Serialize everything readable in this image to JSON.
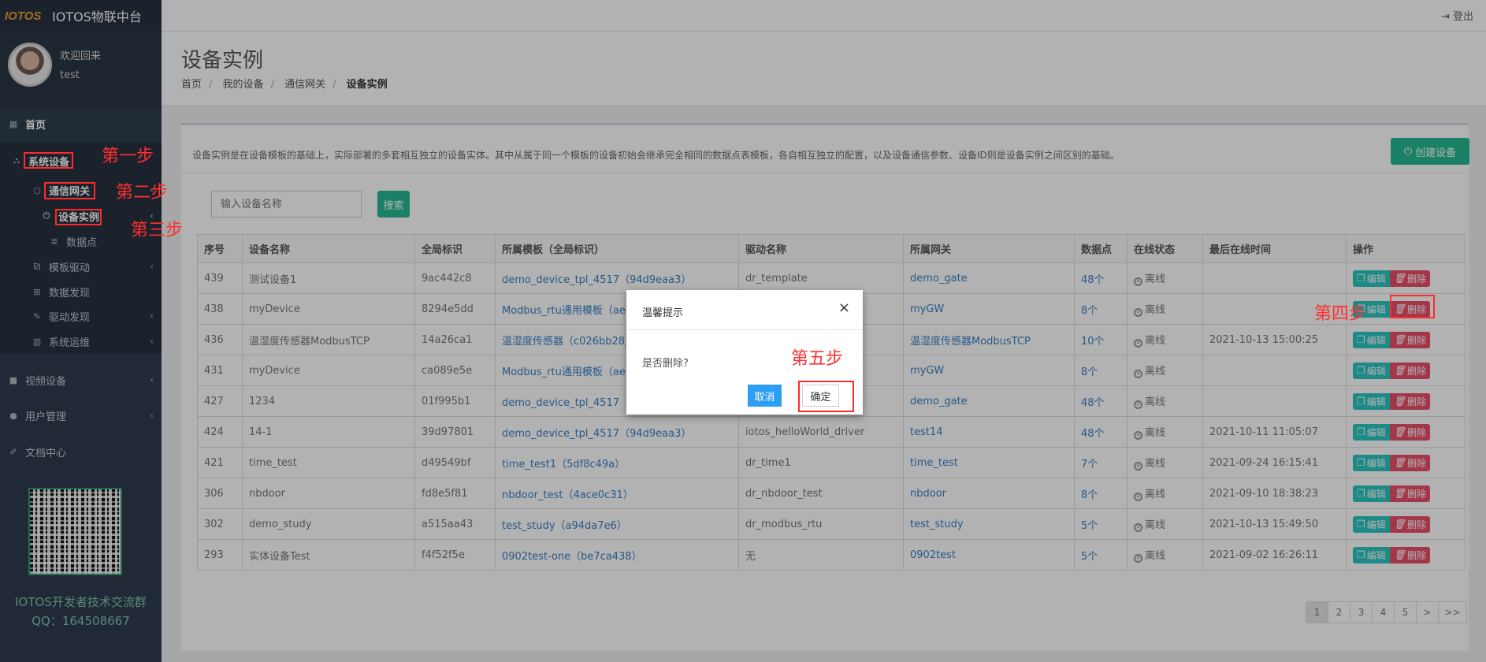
{
  "app": {
    "logo": "IOTOS",
    "title": "IOTOS物联中台",
    "logout": "登出"
  },
  "user": {
    "welcome": "欢迎回来",
    "name": "test"
  },
  "sidebar": {
    "items": [
      {
        "label": "首页",
        "icon": "dashboard-icon"
      },
      {
        "label": "系统设备",
        "icon": "sitemap-icon"
      },
      {
        "label": "通信网关",
        "icon": "circle-icon"
      },
      {
        "label": "设备实例",
        "icon": "rebel-icon"
      },
      {
        "label": "数据点",
        "icon": "database-icon"
      },
      {
        "label": "模板驱动",
        "icon": "template-icon"
      },
      {
        "label": "数据发现",
        "icon": "table-icon"
      },
      {
        "label": "驱动发现",
        "icon": "plug-icon"
      },
      {
        "label": "系统运维",
        "icon": "chart-icon"
      },
      {
        "label": "视频设备",
        "icon": "video-icon"
      },
      {
        "label": "用户管理",
        "icon": "user-icon"
      },
      {
        "label": "文档中心",
        "icon": "edit-icon"
      }
    ],
    "qr_caption": "IOTOS开发者技术交流群",
    "qq": "QQ：164508667"
  },
  "page": {
    "title": "设备实例",
    "breadcrumb": [
      "首页",
      "我的设备",
      "通信网关",
      "设备实例"
    ],
    "description": "设备实例是在设备模板的基础上，实际部署的多套相互独立的设备实体。其中从属于同一个模板的设备初始会继承完全相同的数据点表模板，各自相互独立的配置，以及设备通信参数、设备ID则是设备实例之间区别的基础。",
    "create_button": "创建设备",
    "search_placeholder": "输入设备名称",
    "search_button": "搜索"
  },
  "table": {
    "columns": [
      "序号",
      "设备名称",
      "全局标识",
      "所属模板（全局标识）",
      "驱动名称",
      "所属网关",
      "数据点",
      "在线状态",
      "最后在线时间",
      "操作"
    ],
    "edit_label": "编辑",
    "delete_label": "删除",
    "rows": [
      [
        "439",
        "测试设备1",
        "9ac442c8",
        "demo_device_tpl_4517（94d9eaa3）",
        "dr_template",
        "demo_gate",
        "48个",
        "离线",
        ""
      ],
      [
        "438",
        "myDevice",
        "8294e5dd",
        "Modbus_rtu通用模板（ae6",
        "",
        "myGW",
        "8个",
        "离线",
        ""
      ],
      [
        "436",
        "温湿度传感器ModbusTCP",
        "14a26ca1",
        "温湿度传感器（c026bb28）",
        "",
        "温湿度传感器ModbusTCP",
        "10个",
        "离线",
        "2021-10-13 15:00:25"
      ],
      [
        "431",
        "myDevice",
        "ca089e5e",
        "Modbus_rtu通用模板（ae6",
        "",
        "myGW",
        "8个",
        "离线",
        ""
      ],
      [
        "427",
        "1234",
        "01f995b1",
        "demo_device_tpl_4517（94",
        "",
        "demo_gate",
        "48个",
        "离线",
        ""
      ],
      [
        "424",
        "14-1",
        "39d97801",
        "demo_device_tpl_4517（94d9eaa3）",
        "iotos_helloWorld_driver",
        "test14",
        "48个",
        "离线",
        "2021-10-11 11:05:07"
      ],
      [
        "421",
        "time_test",
        "d49549bf",
        "time_test1（5df8c49a）",
        "dr_time1",
        "time_test",
        "7个",
        "离线",
        "2021-09-24 16:15:41"
      ],
      [
        "306",
        "nbdoor",
        "fd8e5f81",
        "nbdoor_test（4ace0c31）",
        "dr_nbdoor_test",
        "nbdoor",
        "8个",
        "离线",
        "2021-09-10 18:38:23"
      ],
      [
        "302",
        "demo_study",
        "a515aa43",
        "test_study（a94da7e6）",
        "dr_modbus_rtu",
        "test_study",
        "5个",
        "离线",
        "2021-10-13 15:49:50"
      ],
      [
        "293",
        "实体设备Test",
        "f4f52f5e",
        "0902test-one（be7ca438）",
        "无",
        "0902test",
        "5个",
        "离线",
        "2021-09-02 16:26:11"
      ]
    ]
  },
  "pagination": {
    "pages": [
      "1",
      "2",
      "3",
      "4",
      "5",
      ">",
      ">>"
    ],
    "current": "1"
  },
  "modal": {
    "title": "温馨提示",
    "message": "是否删除?",
    "cancel": "取消",
    "confirm": "确定",
    "close": "×"
  },
  "annotations": [
    "第一步",
    "第二步",
    "第三步",
    "第四步",
    "第五步"
  ],
  "colors": {
    "accent": "#26b992",
    "annotation": "#ff3030",
    "link": "#3a7fc4"
  }
}
